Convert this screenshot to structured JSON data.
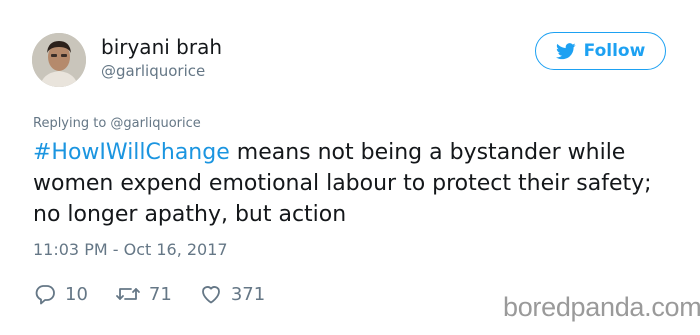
{
  "user": {
    "display_name": "biryani brah",
    "handle": "@garliquorice"
  },
  "follow_button": {
    "label": "Follow",
    "icon": "twitter-bird-icon",
    "color": "#1da1f2"
  },
  "tweet": {
    "replying_to": "Replying to @garliquorice",
    "hashtag": "#HowIWillChange",
    "text": " means not being a bystander while women expend emotional labour to protect their safety; no longer apathy, but action",
    "timestamp": "11:03 PM - Oct 16, 2017",
    "hashtag_color": "#1b95e0"
  },
  "actions": {
    "replies": "10",
    "retweets": "71",
    "likes": "371",
    "icons": [
      "reply-icon",
      "retweet-icon",
      "like-icon"
    ]
  },
  "watermark": "boredpanda.com"
}
